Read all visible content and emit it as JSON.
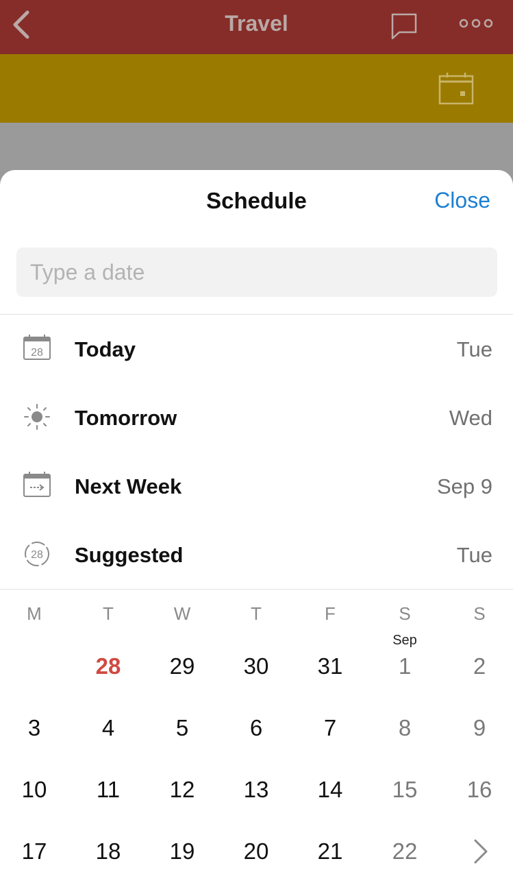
{
  "header": {
    "title": "Travel",
    "back_icon": "chevron-left-icon",
    "comment_icon": "comment-icon",
    "more_icon": "more-dots-icon"
  },
  "band": {
    "calendar_icon": "calendar-icon"
  },
  "sheet": {
    "title": "Schedule",
    "close_label": "Close",
    "date_input": {
      "placeholder": "Type a date",
      "value": ""
    }
  },
  "options": [
    {
      "icon": "calendar-today-icon",
      "icon_text": "28",
      "label": "Today",
      "value": "Tue"
    },
    {
      "icon": "sun-icon",
      "label": "Tomorrow",
      "value": "Wed"
    },
    {
      "icon": "calendar-next-week-icon",
      "label": "Next Week",
      "value": "Sep 9"
    },
    {
      "icon": "suggested-icon",
      "icon_text": "28",
      "label": "Suggested",
      "value": "Tue"
    }
  ],
  "calendar": {
    "weekdays": [
      "M",
      "T",
      "W",
      "T",
      "F",
      "S",
      "S"
    ],
    "month_label": "Sep",
    "rows": [
      [
        "",
        "28",
        "29",
        "30",
        "31",
        "1",
        "2"
      ],
      [
        "3",
        "4",
        "5",
        "6",
        "7",
        "8",
        "9"
      ],
      [
        "10",
        "11",
        "12",
        "13",
        "14",
        "15",
        "16"
      ],
      [
        "17",
        "18",
        "19",
        "20",
        "21",
        "22",
        ""
      ]
    ],
    "next_icon": "chevron-right-icon"
  },
  "colors": {
    "header": "#862d29",
    "band": "#9b7a00",
    "accent": "#1d7fd3",
    "today": "#cf4a43"
  }
}
